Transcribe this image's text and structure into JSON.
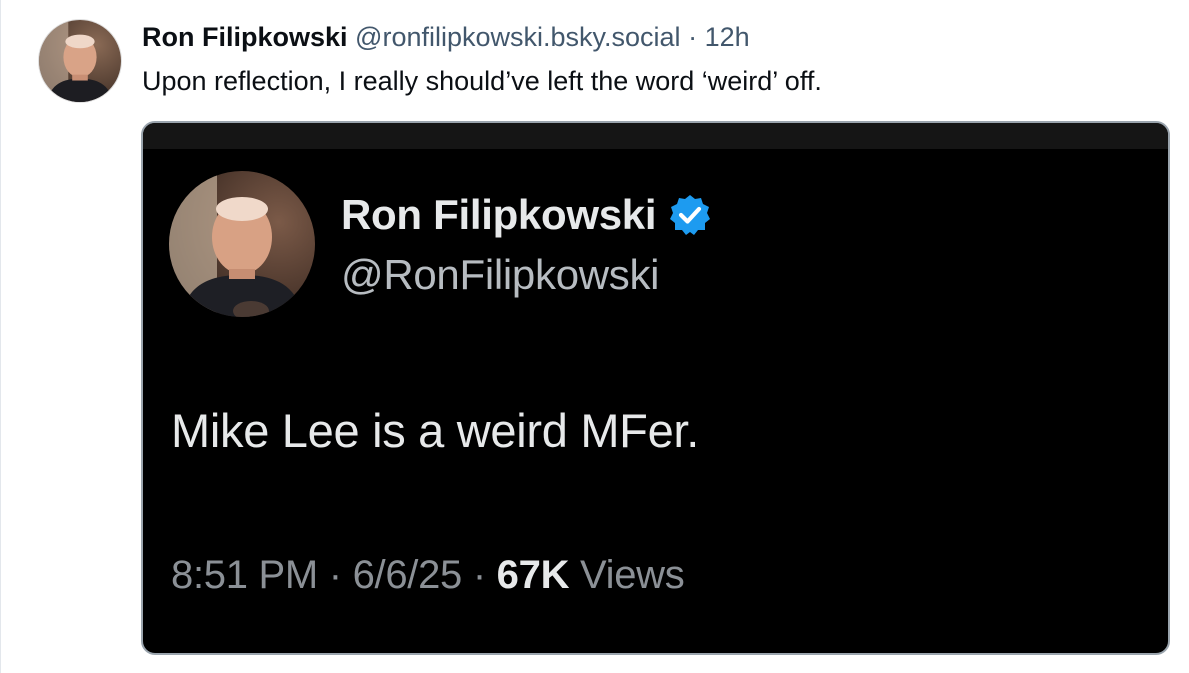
{
  "post": {
    "author_name": "Ron Filipkowski",
    "author_handle": "@ronfilipkowski.bsky.social",
    "separator": "·",
    "time": "12h",
    "text": "Upon reflection, I really should’ve left the word ‘weird’ off.",
    "avatar_icon": "avatar-photo"
  },
  "embed": {
    "author_name": "Ron Filipkowski",
    "verified_icon": "verified-badge-icon",
    "author_handle": "@RonFilipkowski",
    "text": "Mike Lee is a weird MFer.",
    "time": "8:51 PM",
    "sep1": "·",
    "date": "6/6/25",
    "sep2": "·",
    "views_count": "67K",
    "views_label": "Views"
  },
  "colors": {
    "verified_blue": "#1d9bf0",
    "embed_background": "#000000",
    "muted_text": "#42576c"
  }
}
